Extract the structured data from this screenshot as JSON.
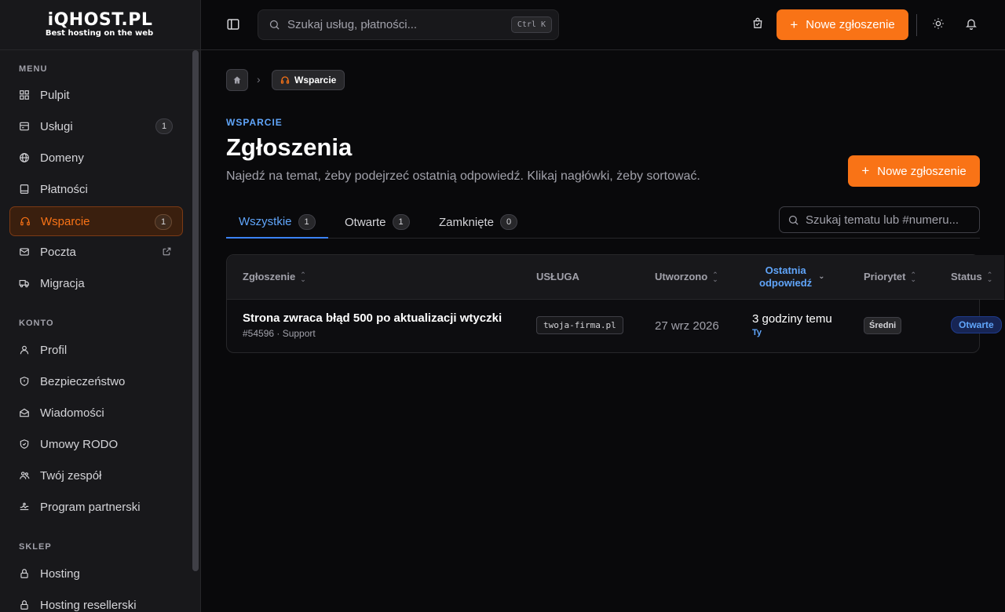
{
  "brand": {
    "name": "iQHOST.PL",
    "tagline": "Best hosting on the web"
  },
  "sidebar": {
    "sections": {
      "menu": "MENU",
      "account": "KONTO",
      "shop": "SKLEP"
    },
    "menu": [
      {
        "label": "Pulpit",
        "icon": "grid-icon"
      },
      {
        "label": "Usługi",
        "icon": "server-icon",
        "badge": "1"
      },
      {
        "label": "Domeny",
        "icon": "globe-icon"
      },
      {
        "label": "Płatności",
        "icon": "receipt-icon"
      },
      {
        "label": "Wsparcie",
        "icon": "headset-icon",
        "badge": "1",
        "active": true
      },
      {
        "label": "Poczta",
        "icon": "mail-icon",
        "external": true
      },
      {
        "label": "Migracja",
        "icon": "truck-icon"
      }
    ],
    "account": [
      {
        "label": "Profil",
        "icon": "user-icon"
      },
      {
        "label": "Bezpieczeństwo",
        "icon": "shield-icon"
      },
      {
        "label": "Wiadomości",
        "icon": "envelope-icon"
      },
      {
        "label": "Umowy RODO",
        "icon": "shield-check-icon"
      },
      {
        "label": "Twój zespół",
        "icon": "users-icon"
      },
      {
        "label": "Program partnerski",
        "icon": "handshake-icon"
      }
    ],
    "shop": [
      {
        "label": "Hosting",
        "icon": "lock-icon"
      },
      {
        "label": "Hosting resellerski",
        "icon": "lock-icon"
      }
    ]
  },
  "topbar": {
    "search_placeholder": "Szukaj usług, płatności...",
    "search_shortcut": "Ctrl K",
    "new_ticket_label": "Nowe zgłoszenie"
  },
  "breadcrumb": {
    "current": "Wsparcie"
  },
  "page": {
    "eyebrow": "WSPARCIE",
    "title": "Zgłoszenia",
    "subtitle": "Najedź na temat, żeby podejrzeć ostatnią odpowiedź. Klikaj nagłówki, żeby sortować.",
    "new_ticket_label": "Nowe zgłoszenie"
  },
  "tabs": [
    {
      "label": "Wszystkie",
      "count": "1",
      "active": true
    },
    {
      "label": "Otwarte",
      "count": "1"
    },
    {
      "label": "Zamknięte",
      "count": "0"
    }
  ],
  "ticket_search_placeholder": "Szukaj tematu lub #numeru...",
  "table": {
    "columns": {
      "subject": "Zgłoszenie",
      "service": "USŁUGA",
      "created": "Utworzono",
      "last_reply_1": "Ostatnia",
      "last_reply_2": "odpowiedź",
      "priority": "Priorytet",
      "status": "Status"
    },
    "rows": [
      {
        "subject": "Strona zwraca błąd 500 po aktualizacji wtyczki",
        "meta": "#54596 · Support",
        "service": "twoja-firma.pl",
        "created": "27 wrz 2026",
        "last_reply": "3 godziny temu",
        "last_reply_by": "Ty",
        "priority": "Średni",
        "status": "Otwarte"
      }
    ]
  }
}
